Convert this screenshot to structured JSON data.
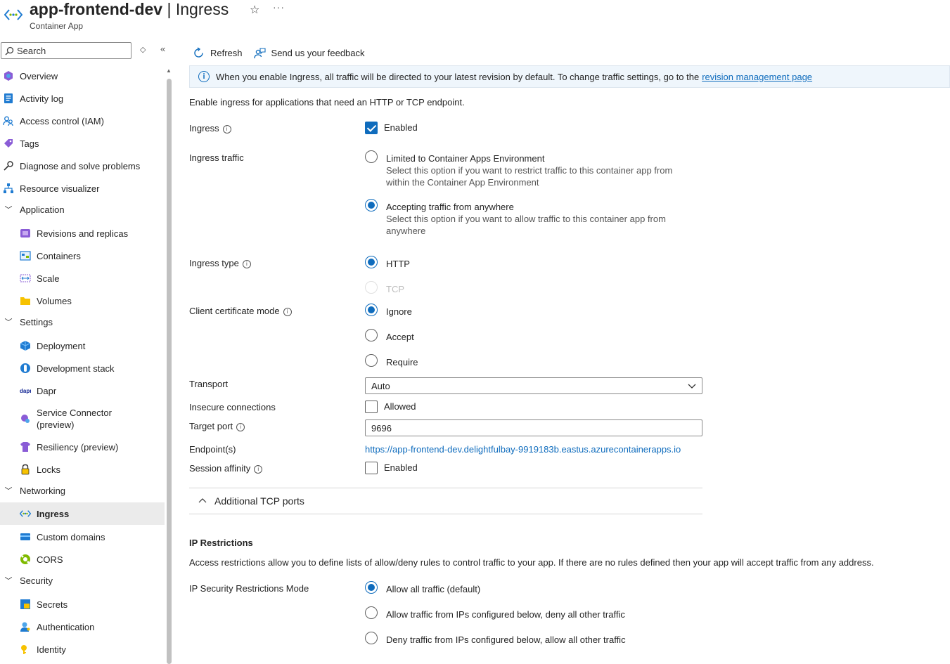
{
  "header": {
    "title_resource": "app-frontend-dev",
    "title_separator": " | ",
    "title_page": "Ingress",
    "subtitle": "Container App",
    "more": "···"
  },
  "sidebar": {
    "search_placeholder": "Search",
    "items": [
      {
        "label": "Overview",
        "icon": "overview-icon"
      },
      {
        "label": "Activity log",
        "icon": "activity-log-icon"
      },
      {
        "label": "Access control (IAM)",
        "icon": "access-control-icon"
      },
      {
        "label": "Tags",
        "icon": "tag-icon"
      },
      {
        "label": "Diagnose and solve problems",
        "icon": "wrench-icon"
      },
      {
        "label": "Resource visualizer",
        "icon": "resource-visualizer-icon"
      },
      {
        "label": "Application",
        "icon": "chevron-down-icon"
      },
      {
        "label": "Revisions and replicas",
        "icon": "revisions-icon"
      },
      {
        "label": "Containers",
        "icon": "containers-icon"
      },
      {
        "label": "Scale",
        "icon": "scale-icon"
      },
      {
        "label": "Volumes",
        "icon": "folder-icon"
      },
      {
        "label": "Settings",
        "icon": "chevron-down-icon"
      },
      {
        "label": "Deployment",
        "icon": "deployment-icon"
      },
      {
        "label": "Development stack",
        "icon": "development-stack-icon"
      },
      {
        "label": "Dapr",
        "icon": "dapr-icon"
      },
      {
        "label": "Service Connector (preview)",
        "icon": "service-connector-icon"
      },
      {
        "label": "Resiliency (preview)",
        "icon": "resiliency-icon"
      },
      {
        "label": "Locks",
        "icon": "lock-icon"
      },
      {
        "label": "Networking",
        "icon": "chevron-down-icon"
      },
      {
        "label": "Ingress",
        "icon": "ingress-icon"
      },
      {
        "label": "Custom domains",
        "icon": "custom-domains-icon"
      },
      {
        "label": "CORS",
        "icon": "cors-icon"
      },
      {
        "label": "Security",
        "icon": "chevron-down-icon"
      },
      {
        "label": "Secrets",
        "icon": "secrets-icon"
      },
      {
        "label": "Authentication",
        "icon": "authentication-icon"
      },
      {
        "label": "Identity",
        "icon": "identity-icon"
      }
    ]
  },
  "toolbar": {
    "refresh_label": "Refresh",
    "feedback_label": "Send us your feedback"
  },
  "info_banner": {
    "text": "When you enable Ingress, all traffic will be directed to your latest revision by default. To change traffic settings, go to the",
    "link_text": "revision management page"
  },
  "form": {
    "intro": "Enable ingress for applications that need an HTTP or TCP endpoint.",
    "ingress": {
      "label": "Ingress",
      "checkbox_label": "Enabled",
      "checked": true
    },
    "ingress_traffic": {
      "label": "Ingress traffic",
      "opt1_title": "Limited to Container Apps Environment",
      "opt1_desc": "Select this option if you want to restrict traffic to this container app from within the Container App Environment",
      "opt2_title": "Accepting traffic from anywhere",
      "opt2_desc": "Select this option if you want to allow traffic to this container app from anywhere",
      "selected": "Accepting traffic from anywhere"
    },
    "ingress_type": {
      "label": "Ingress type",
      "opt_http": "HTTP",
      "opt_tcp": "TCP",
      "selected": "HTTP"
    },
    "client_cert": {
      "label": "Client certificate mode",
      "opt_ignore": "Ignore",
      "opt_accept": "Accept",
      "opt_require": "Require",
      "selected": "Ignore"
    },
    "transport": {
      "label": "Transport",
      "value": "Auto"
    },
    "insecure": {
      "label": "Insecure connections",
      "checkbox_label": "Allowed",
      "checked": false
    },
    "target_port": {
      "label": "Target port",
      "value": "9696"
    },
    "endpoints": {
      "label": "Endpoint(s)",
      "url": "https://app-frontend-dev.delightfulbay-9919183b.eastus.azurecontainerapps.io"
    },
    "session_affinity": {
      "label": "Session affinity",
      "checkbox_label": "Enabled",
      "checked": false
    },
    "additional_tcp": "Additional TCP ports"
  },
  "ip_restrictions": {
    "heading": "IP Restrictions",
    "description": "Access restrictions allow you to define lists of allow/deny rules to control traffic to your app. If there are no rules defined then your app will accept traffic from any address.",
    "mode_label": "IP Security Restrictions Mode",
    "opt_allow_all": "Allow all traffic (default)",
    "opt_allow_listed": "Allow traffic from IPs configured below, deny all other traffic",
    "opt_deny_listed": "Deny traffic from IPs configured below, allow all other traffic",
    "selected": "Allow all traffic (default)"
  },
  "colors": {
    "accent": "#0f6cbd",
    "active_nav": "#ebebeb",
    "info_bg": "#eff6fc"
  }
}
